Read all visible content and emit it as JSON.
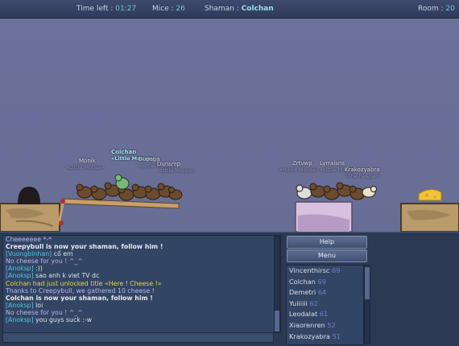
{
  "hud": {
    "time_label": "Time left :",
    "time_value": "01:27",
    "mice_label": "Mice :",
    "mice_value": "26",
    "shaman_label": "Shaman :",
    "shaman_value": "Colchan",
    "room_label": "Room :",
    "room_value": "20"
  },
  "colors": {
    "system": "#b6b6f2",
    "whisper_tag": "#50c7e6",
    "server": "#e0d64a",
    "chat": "#dfe3f0"
  },
  "players_on_map": {
    "shaman_name": "Colchan",
    "shaman_title": "«Little Mouse»",
    "left_group": {
      "name1": "Monik",
      "title1": "«Little Mouse»",
      "name2": "Bupapa",
      "title2": "«Little Mouse»",
      "name3": "Dunsmp",
      "title3": "«Little Mouse»"
    },
    "right_group": {
      "name1": "Zrtvwp",
      "title1": "«Hawk Mouse»",
      "name2": "Lyrraisns",
      "title2": "«Little Mouse»",
      "name3": "Krakozyabra",
      "title3": "«The Reaper»"
    }
  },
  "chat": [
    {
      "text": "Cheeeeeee *-*",
      "kind": "system"
    },
    {
      "text": "Creepybull is now your shaman, follow him !",
      "kind": "system_bold"
    },
    {
      "tag": "[Vuongbinhan]",
      "text": " cố em",
      "kind": "player"
    },
    {
      "text": "No cheese for you ! ^_^",
      "kind": "system"
    },
    {
      "tag": "[Anoksp]",
      "text": " :))",
      "kind": "player"
    },
    {
      "tag": "[Anoksp]",
      "text": " sao anh k viet TV dc",
      "kind": "player"
    },
    {
      "text": "Colchan had just unlocked title «Here ! Cheese !»",
      "kind": "server"
    },
    {
      "text": "Thanks to Creepybull, we gathered 10 cheese !",
      "kind": "system"
    },
    {
      "text": "Colchan is now your shaman, follow him !",
      "kind": "system_bold"
    },
    {
      "tag": "[Anoksp]",
      "text": " loi",
      "kind": "player"
    },
    {
      "text": "No cheese for you ! ^_^",
      "kind": "system"
    },
    {
      "tag": "[Anoksp]",
      "text": " you guys suck :-w",
      "kind": "player"
    }
  ],
  "buttons": {
    "help": "Help",
    "menu": "Menu"
  },
  "player_list": [
    {
      "name": "Vincenthirsc",
      "score": "69"
    },
    {
      "name": "Colchan",
      "score": "69"
    },
    {
      "name": "Demetri",
      "score": "64"
    },
    {
      "name": "Yuiiiiii",
      "score": "62"
    },
    {
      "name": "Leodalat",
      "score": "61"
    },
    {
      "name": "Xiaorenren",
      "score": "52"
    },
    {
      "name": "Krakozyabra",
      "score": "51"
    }
  ]
}
